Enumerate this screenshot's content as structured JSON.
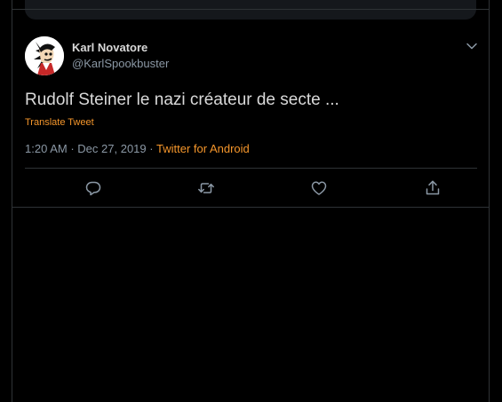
{
  "tweet": {
    "author_name": "Karl Novatore",
    "author_handle": "@KarlSpookbuster",
    "text": "Rudolf Steiner le nazi créateur de secte ...",
    "translate_label": "Translate Tweet",
    "time": "1:20 AM",
    "date": "Dec 27, 2019",
    "separator": "·",
    "source": "Twitter for Android"
  },
  "actions": [
    {
      "name": "reply",
      "icon": "reply-icon"
    },
    {
      "name": "retweet",
      "icon": "retweet-icon"
    },
    {
      "name": "like",
      "icon": "heart-icon"
    },
    {
      "name": "share",
      "icon": "share-icon"
    }
  ],
  "colors": {
    "background": "#000000",
    "text": "#d9d9d9",
    "secondary": "#8b98a5",
    "accent": "#f5962b",
    "border": "#2f3336"
  }
}
